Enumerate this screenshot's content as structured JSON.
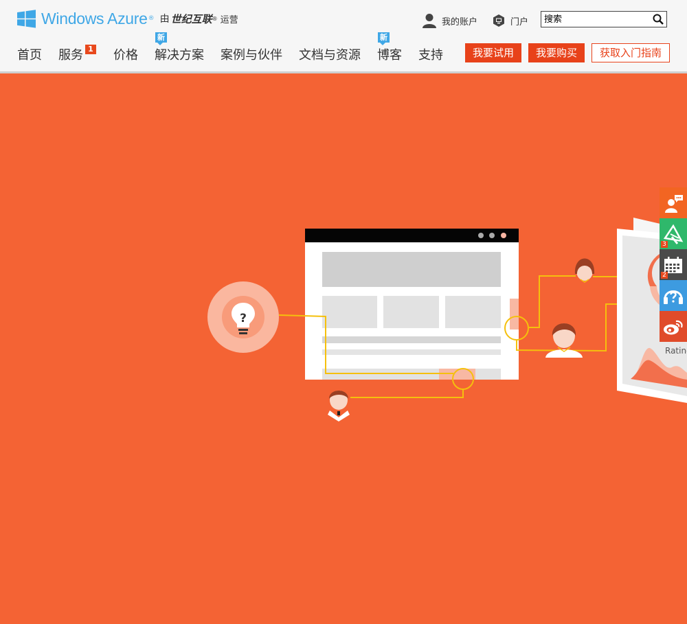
{
  "brand": {
    "logo_text": "Windows Azure",
    "reg_mark": "®",
    "by": "由",
    "partner": "世纪互联",
    "partner_reg": "®",
    "operated": "运营",
    "color": "#3fa7e6"
  },
  "header": {
    "account_label": "我的账户",
    "portal_label": "门户",
    "search_placeholder": "搜索",
    "search_value": ""
  },
  "nav": {
    "items": [
      {
        "label": "首页"
      },
      {
        "label": "服务",
        "badge": "1"
      },
      {
        "label": "价格"
      },
      {
        "label": "解决方案",
        "badge": "新"
      },
      {
        "label": "案例与伙伴"
      },
      {
        "label": "文档与资源"
      },
      {
        "label": "博客",
        "badge": "新"
      },
      {
        "label": "支持"
      }
    ]
  },
  "actions": {
    "trial": "我要试用",
    "buy": "我要购买",
    "guide": "获取入门指南",
    "accent": "#e8421a"
  },
  "hero": {
    "bg_color": "#f46334",
    "rating_text": "Rating",
    "question_mark": "?"
  },
  "sidebar": {
    "items": [
      {
        "icon": "customer-service-chat-icon",
        "color": "#f26522"
      },
      {
        "icon": "announcement-megaphone-icon",
        "color": "#2fb86b",
        "badge": "3"
      },
      {
        "icon": "calendar-icon",
        "color": "#4a4a4a",
        "badge": "2"
      },
      {
        "icon": "help-headset-icon",
        "color": "#3d9be0"
      },
      {
        "icon": "weibo-icon",
        "color": "#e04b2a"
      }
    ]
  }
}
